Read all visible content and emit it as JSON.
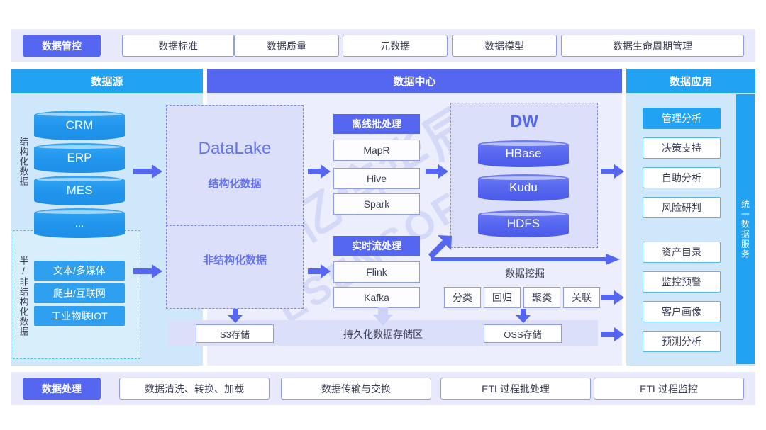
{
  "top_bar": {
    "active": "数据管控",
    "items": [
      "数据标准",
      "数据质量",
      "元数据",
      "数据模型",
      "数据生命周期管理"
    ]
  },
  "bottom_bar": {
    "active": "数据处理",
    "items": [
      "数据清洗、转换、加载",
      "数据传输与交换",
      "ETL过程批处理",
      "ETL过程监控"
    ]
  },
  "columns": {
    "source_title": "数据源",
    "center_title": "数据中心",
    "app_title": "数据应用"
  },
  "source": {
    "structured_label": "结构化数据",
    "unstructured_label": "半/非结构化数据",
    "cylinders": [
      "CRM",
      "ERP",
      "MES",
      "..."
    ],
    "boxes": [
      "文本/多媒体",
      "爬虫/互联网",
      "工业物联IOT"
    ]
  },
  "lake": {
    "name": "DataLake",
    "structured": "结构化数据",
    "unstructured": "非结构化数据"
  },
  "batch": {
    "title": "离线批处理",
    "items": [
      "MapR",
      "Hive",
      "Spark"
    ]
  },
  "stream": {
    "title": "实时流处理",
    "items": [
      "Flink",
      "Kafka"
    ]
  },
  "dw": {
    "title": "DW",
    "cylinders": [
      "HBase",
      "Kudu",
      "HDFS"
    ]
  },
  "mining": {
    "title": "数据挖掘",
    "items": [
      "分类",
      "回归",
      "聚类",
      "关联"
    ]
  },
  "persistence": {
    "title": "持久化数据存储区",
    "left_store": "S3存储",
    "right_store": "OSS存储"
  },
  "apps": {
    "group_a": [
      "管理分析",
      "决策支持",
      "自助分析",
      "风险研判"
    ],
    "group_b": [
      "资产目录",
      "监控预警",
      "客户画像",
      "预测分析"
    ]
  },
  "service_bar": "统一数据服务",
  "watermark": {
    "line1": "亿信华辰",
    "line2": "ESENSOFT"
  },
  "colors": {
    "blue": "#22a2f2",
    "indigo": "#5566f0",
    "light_blue_panel": "#cfe7fb",
    "light_indigo_panel": "#eceefd",
    "strip_bg": "#e8eafc"
  }
}
